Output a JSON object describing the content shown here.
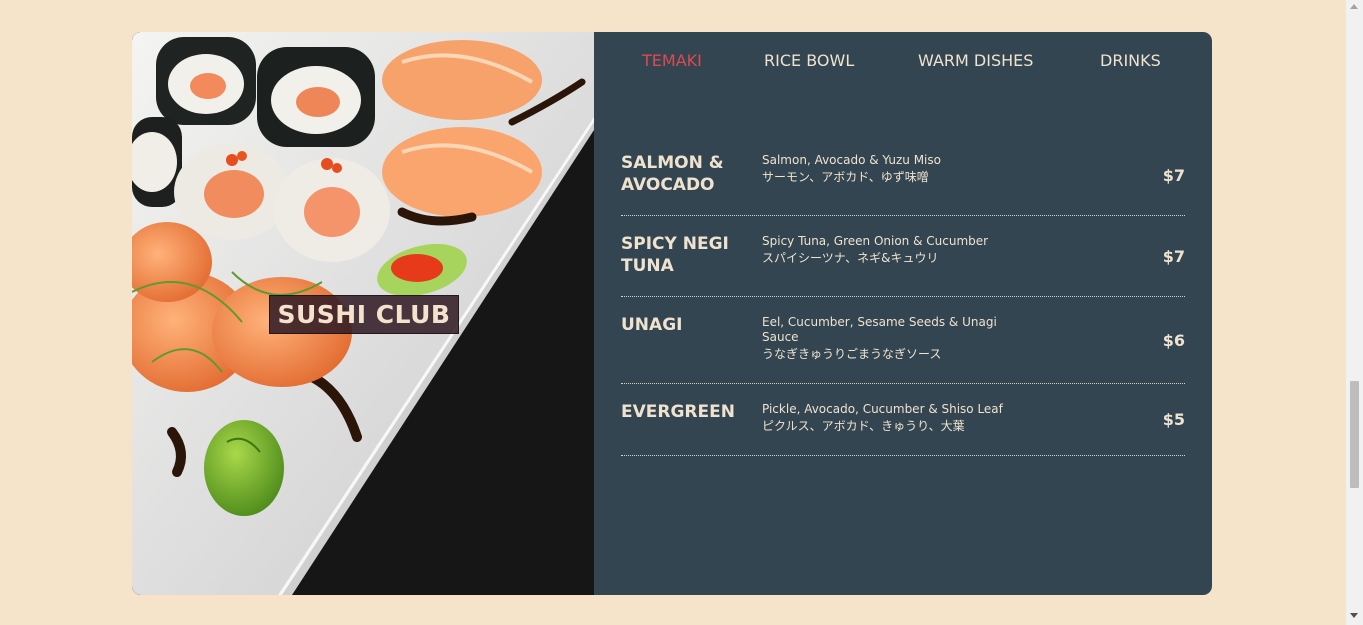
{
  "brand": {
    "title": "SUSHI CLUB"
  },
  "tabs": [
    {
      "label": "TEMAKI",
      "active": true
    },
    {
      "label": "RICE BOWL",
      "active": false
    },
    {
      "label": "WARM DISHES",
      "active": false
    },
    {
      "label": "DRINKS",
      "active": false
    }
  ],
  "items": [
    {
      "name": "SALMON & AVOCADO",
      "desc": "Salmon, Avocado & Yuzu Miso",
      "jp": "サーモン、アボカド、ゆず味噌",
      "price": "$7"
    },
    {
      "name": "SPICY NEGI TUNA",
      "desc": "Spicy Tuna, Green Onion & Cucumber",
      "jp": "スパイシーツナ、ネギ&キュウリ",
      "price": "$7"
    },
    {
      "name": "UNAGI",
      "desc": "Eel, Cucumber, Sesame Seeds & Unagi Sauce",
      "jp": "うなぎきゅうりごまうなぎソース",
      "price": "$6"
    },
    {
      "name": "EVERGREEN",
      "desc": "Pickle, Avocado, Cucumber & Shiso Leaf",
      "jp": "ピクルス、アボカド、きゅうり、大葉",
      "price": "$5"
    }
  ],
  "colors": {
    "background": "#f5e4c9",
    "panel": "#324550",
    "accent": "#dc4a53",
    "text": "#efe2cf"
  }
}
